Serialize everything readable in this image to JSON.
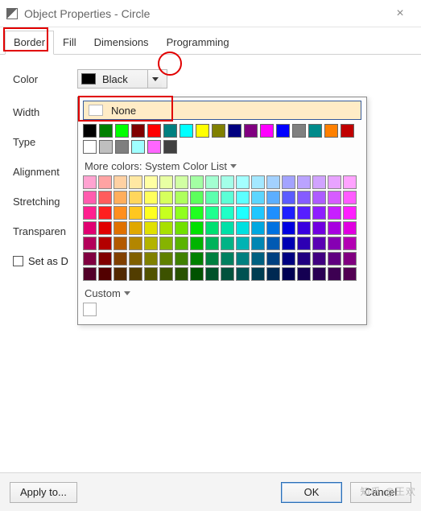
{
  "window": {
    "title": "Object Properties - Circle"
  },
  "tabs": {
    "border": "Border",
    "fill": "Fill",
    "dimensions": "Dimensions",
    "programming": "Programming"
  },
  "fields": {
    "color": "Color",
    "width": "Width",
    "type": "Type",
    "alignment": "Alignment",
    "stretching": "Stretching",
    "transparency": "Transparen",
    "set_as_default": "Set as D"
  },
  "color_combo": {
    "value_label": "Black",
    "value_hex": "#000000"
  },
  "popup": {
    "none_label": "None",
    "more_colors_label": "More colors: System Color List",
    "custom_label": "Custom",
    "basic_palette": [
      "#000000",
      "#008000",
      "#00ff00",
      "#800000",
      "#ff0000",
      "#008080",
      "#00ffff",
      "#ffff00",
      "#808000",
      "#000080",
      "#800080",
      "#ff00ff",
      "#0000ff",
      "#808080",
      "#008b8b",
      "#ff8000",
      "#c00000",
      "#ffffff",
      "#bfbfbf",
      "#7f7f7f",
      "#9fffff",
      "#ff66ff",
      "#404040"
    ],
    "system_palette_hues": [
      "#ff0080",
      "#ff0000",
      "#ff8000",
      "#ffbf00",
      "#ffff00",
      "#bfff00",
      "#80ff00",
      "#00ff00",
      "#00ff80",
      "#00ffbf",
      "#00ffff",
      "#00bfff",
      "#0080ff",
      "#0000ff",
      "#4000ff",
      "#8000ff",
      "#bf00ff",
      "#ff00ff"
    ],
    "system_palette_lightness": [
      0.82,
      0.68,
      0.56,
      0.44,
      0.35,
      0.25,
      0.16
    ],
    "custom_swatch": "#ffffff"
  },
  "buttons": {
    "apply_to": "Apply to...",
    "ok": "OK",
    "cancel": "Cancel"
  },
  "watermark": "知乎 @王欢"
}
